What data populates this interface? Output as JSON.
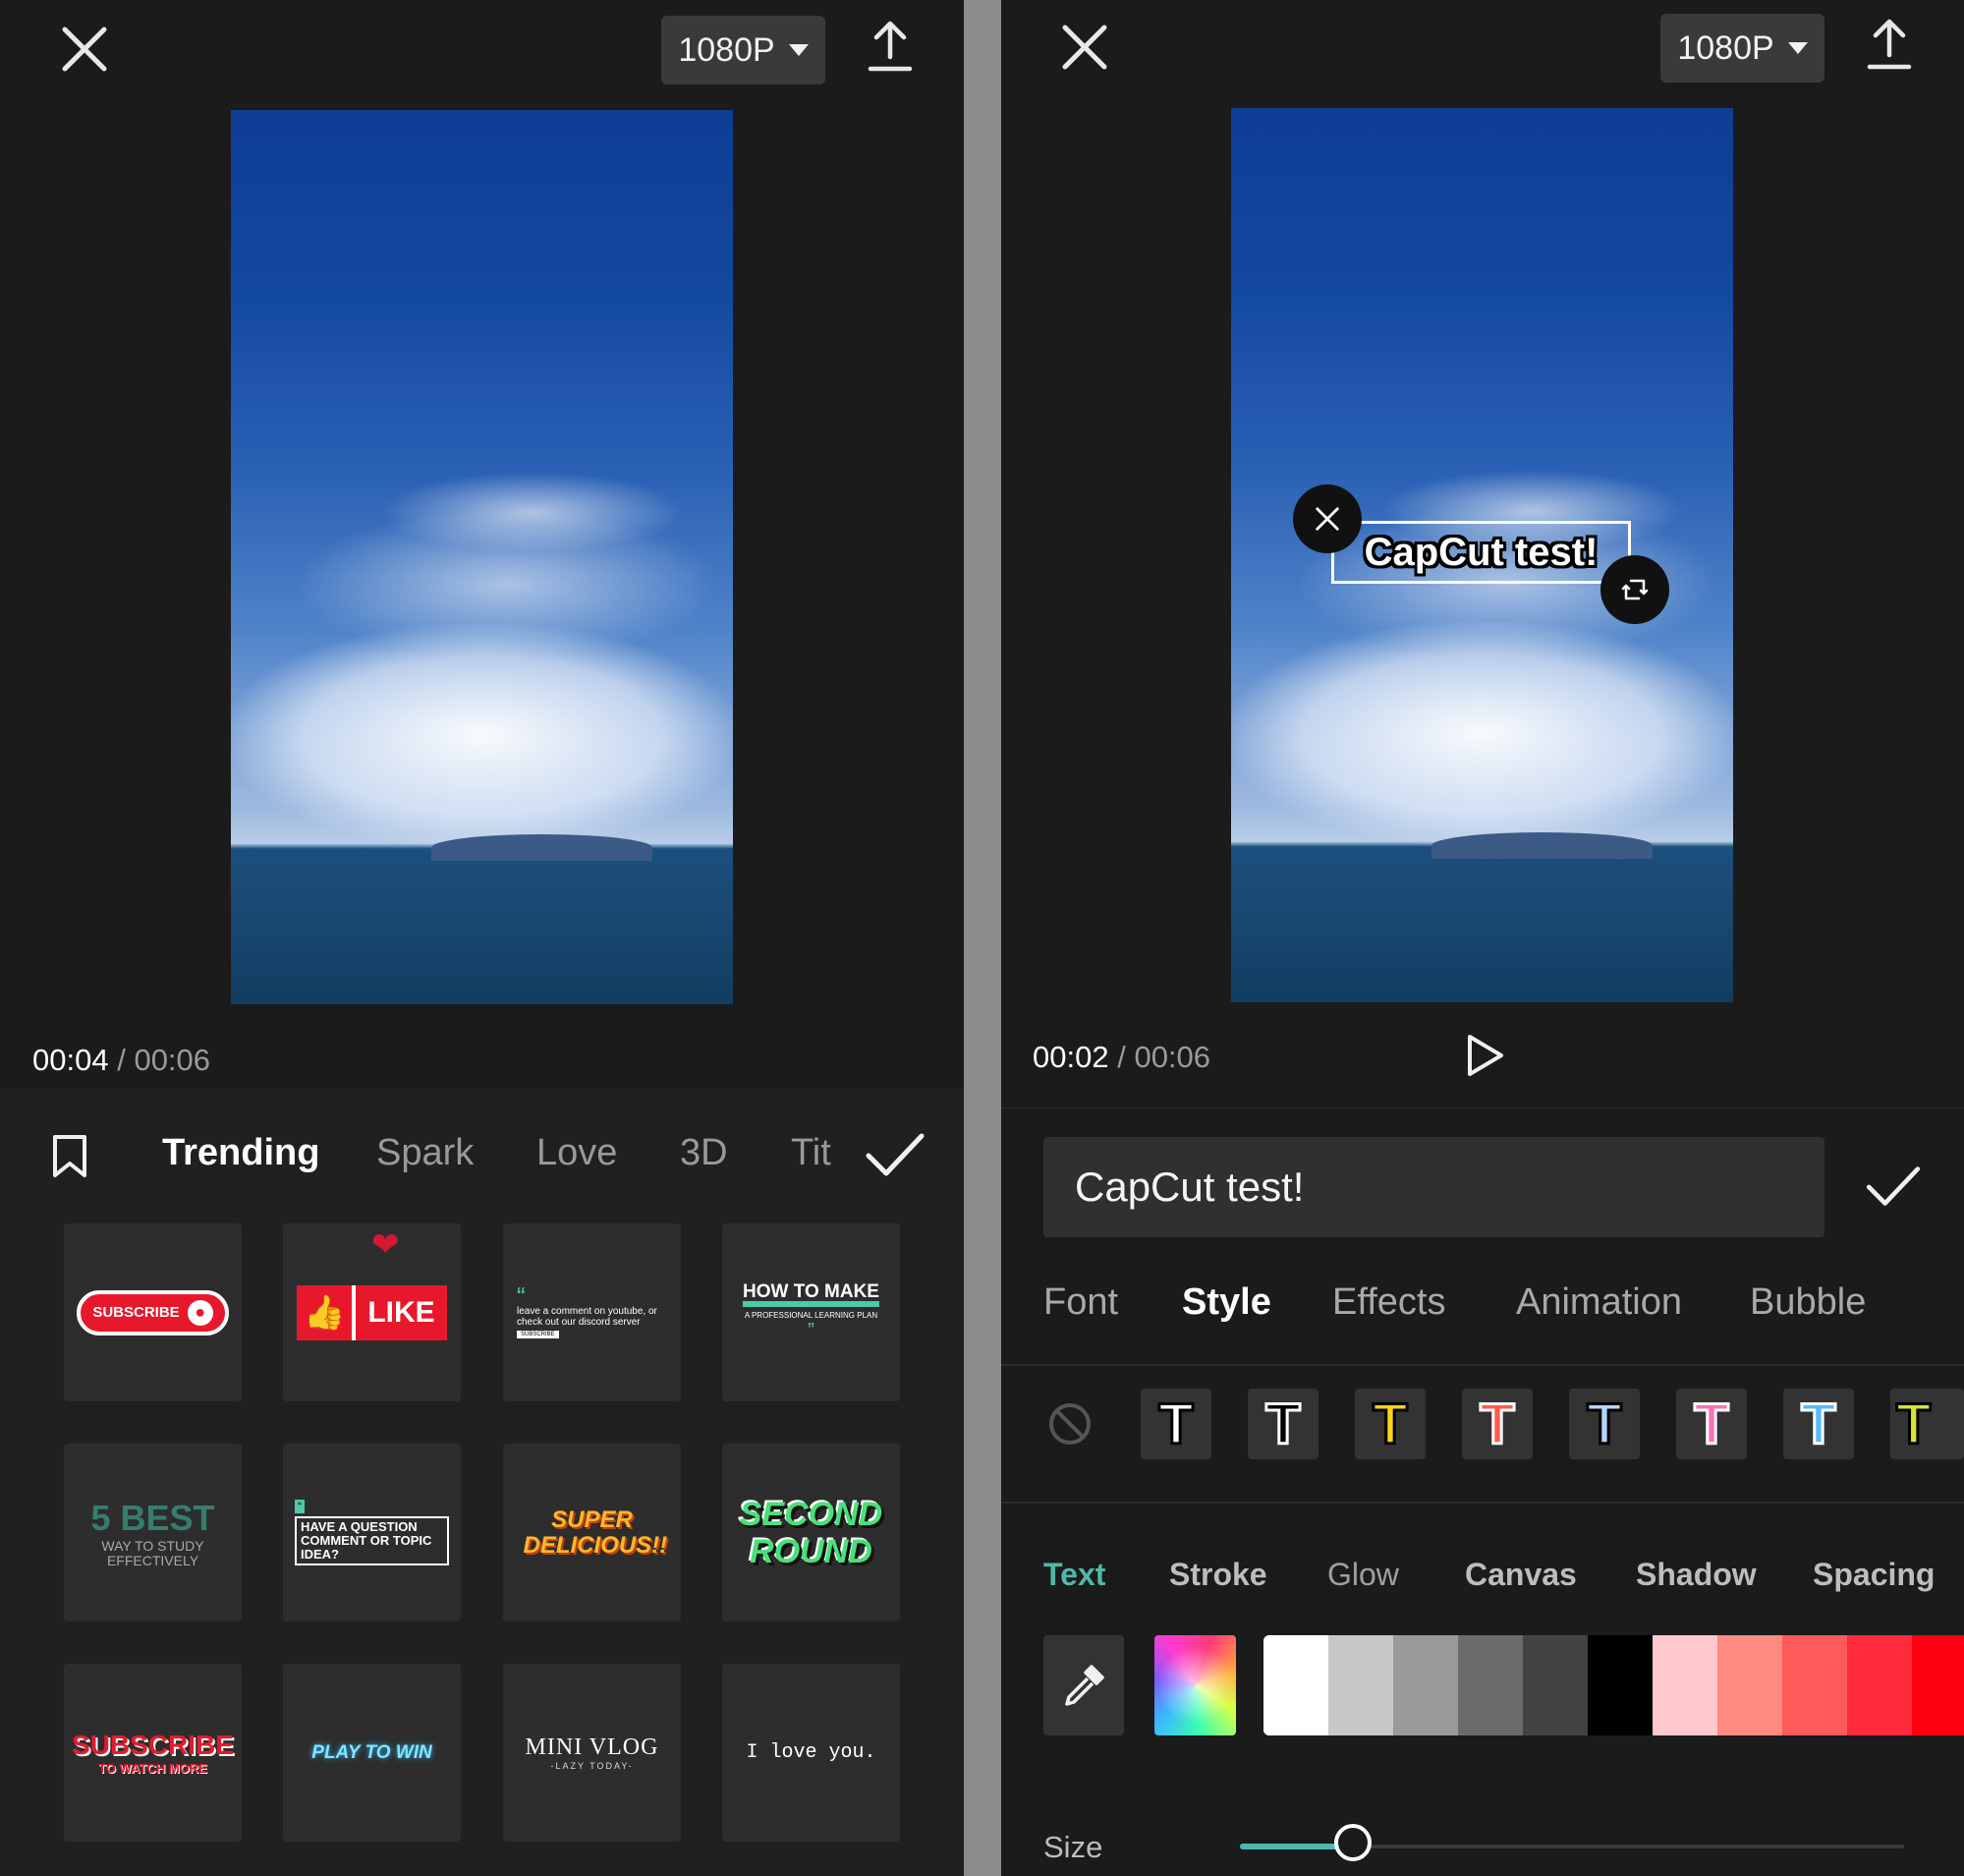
{
  "left": {
    "resolution": "1080P",
    "time_current": "00:04",
    "time_sep": "/",
    "time_total": "00:06",
    "categories": [
      "Trending",
      "Spark",
      "Love",
      "3D",
      "Tit"
    ],
    "templates": [
      {
        "text": "SUBSCRIBE"
      },
      {
        "text": "LIKE"
      },
      {
        "text": "leave a comment on youtube, or check out our discord server",
        "sub": "SUBSCRIBE"
      },
      {
        "text": "HOW TO MAKE",
        "sub": "A PROFESSIONAL LEARNING PLAN"
      },
      {
        "text": "5 BEST",
        "sub": "WAY TO STUDY EFFECTIVELY"
      },
      {
        "text": "HAVE A QUESTION COMMENT OR TOPIC IDEA?"
      },
      {
        "text": "SUPER DELICIOUS!!"
      },
      {
        "text": "SECOND ROUND"
      },
      {
        "text": "SUBSCRIBE",
        "sub": "TO WATCH MORE"
      },
      {
        "text": "PLAY TO WIN"
      },
      {
        "text": "MINI VLOG",
        "sub": "-LAZY TODAY-"
      },
      {
        "text": "I love you."
      }
    ]
  },
  "right": {
    "resolution": "1080P",
    "time_current": "00:02",
    "time_sep": "/",
    "time_total": "00:06",
    "overlay_text": "CapCut test!",
    "input_value": "CapCut test!",
    "tabs": [
      "Font",
      "Style",
      "Effects",
      "Animation",
      "Bubble"
    ],
    "active_tab": "Style",
    "style_presets": [
      "T",
      "T",
      "T",
      "T",
      "T",
      "T",
      "T",
      "T"
    ],
    "sub_tabs": [
      "Text",
      "Stroke",
      "Glow",
      "Canvas",
      "Shadow",
      "Spacing"
    ],
    "active_sub_tab": "Text",
    "size_label": "Size",
    "size_value": 0.17,
    "colors": [
      "#ffffff",
      "#c8c8c8",
      "#9a9a9a",
      "#6b6b6b",
      "#434343",
      "#000000",
      "#ffc8cc",
      "#ff8a80",
      "#ff5a5a",
      "#ff2a3a",
      "#ff0010"
    ]
  }
}
